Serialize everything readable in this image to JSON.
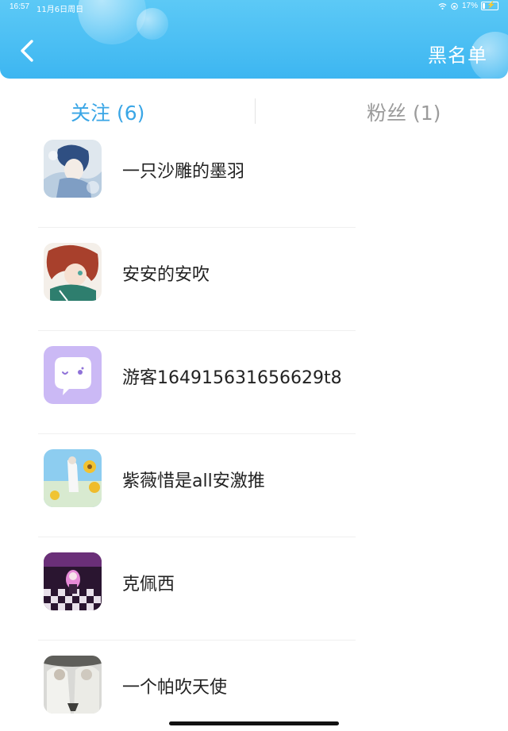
{
  "status_bar": {
    "time": "16:57",
    "date": "11月6日周日",
    "battery": "17%",
    "battery_level": 0.17
  },
  "header": {
    "back_icon": "chevron-left-icon",
    "blacklist_label": "黑名单",
    "gradient_colors": [
      "#5cc9f6",
      "#3db6f1"
    ]
  },
  "tabs": [
    {
      "label": "关注 (6)",
      "active": true,
      "color": "#3aa6e6"
    },
    {
      "label": "粉丝 (1)",
      "active": false,
      "color": "#9b9b9b"
    }
  ],
  "follow_list": [
    {
      "name": "一只沙雕的墨羽",
      "avatar": "anime-boy-blue-hair-avatar"
    },
    {
      "name": "安安的安吹",
      "avatar": "anime-red-hair-avatar"
    },
    {
      "name": "游客164915631656629t8",
      "avatar": "purple-chat-bubble-avatar"
    },
    {
      "name": "紫薇惜是all安激推",
      "avatar": "sunflower-sky-avatar"
    },
    {
      "name": "克佩西",
      "avatar": "pink-hair-checkerboard-avatar"
    },
    {
      "name": "一个帕吹天使",
      "avatar": "two-figures-gray-avatar"
    }
  ]
}
